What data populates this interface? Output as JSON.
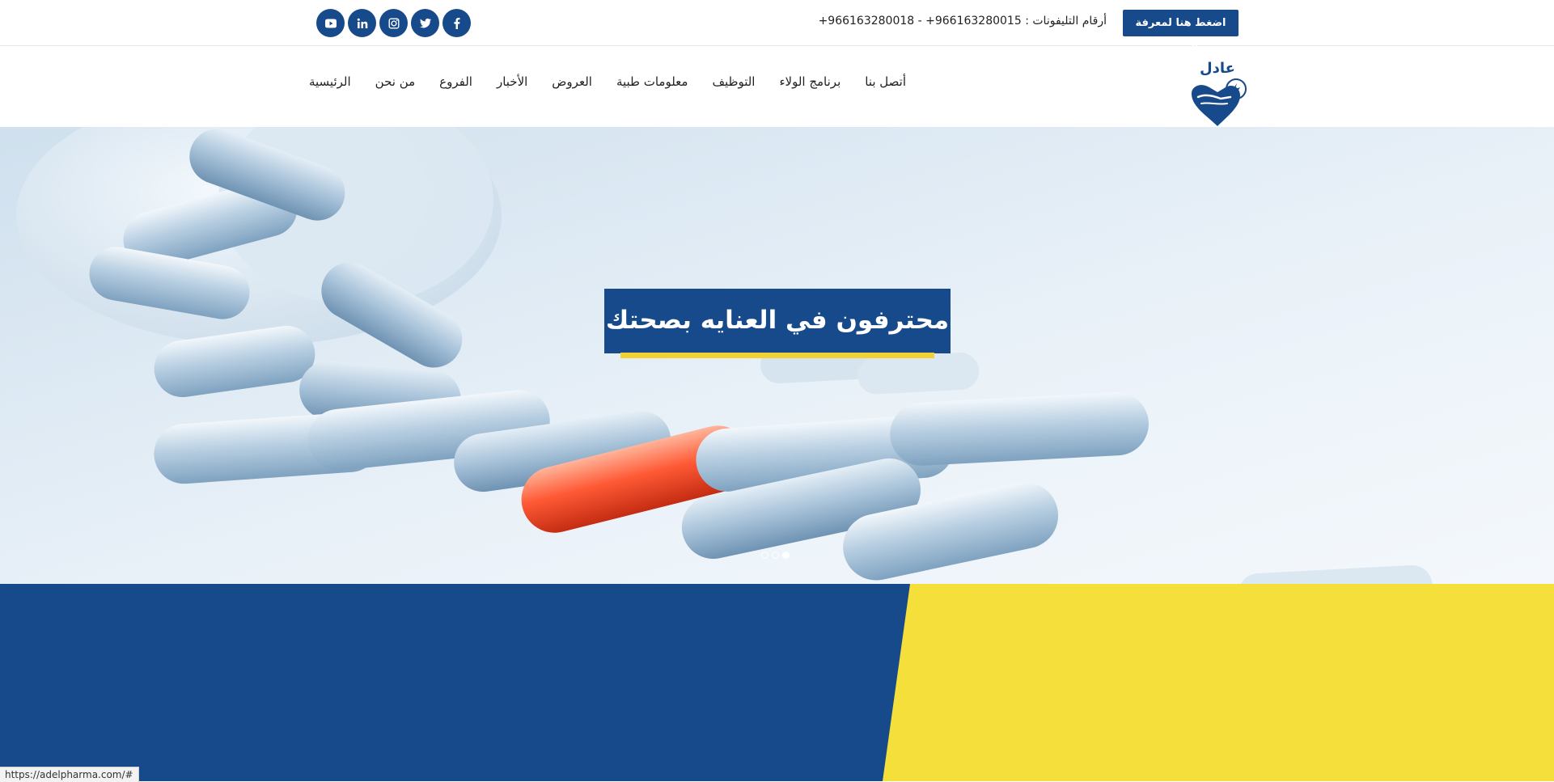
{
  "topbar": {
    "branch_button": "اضغط هنا لمعرفة الفروع",
    "phones_label": "أرقام التليفونات :",
    "phones_numbers": "+966163280018 - +966163280015",
    "socials": [
      "facebook-icon",
      "twitter-icon",
      "instagram-icon",
      "linkedin-icon",
      "youtube-icon"
    ]
  },
  "logo": {
    "text": "عادل"
  },
  "nav": {
    "items": [
      "الرئيسية",
      "من نحن",
      "الفروع",
      "الأخبار",
      "العروض",
      "معلومات طبية",
      "التوظيف",
      "برنامج الولاء",
      "أتصل بنا"
    ]
  },
  "hero": {
    "title": "محترفون في العنايه بصحتك",
    "slides": 3,
    "active_slide": 3
  },
  "colors": {
    "brand_blue": "#174a8a",
    "brand_yellow": "#f5df3a"
  },
  "status_url": "https://adelpharma.com/#"
}
